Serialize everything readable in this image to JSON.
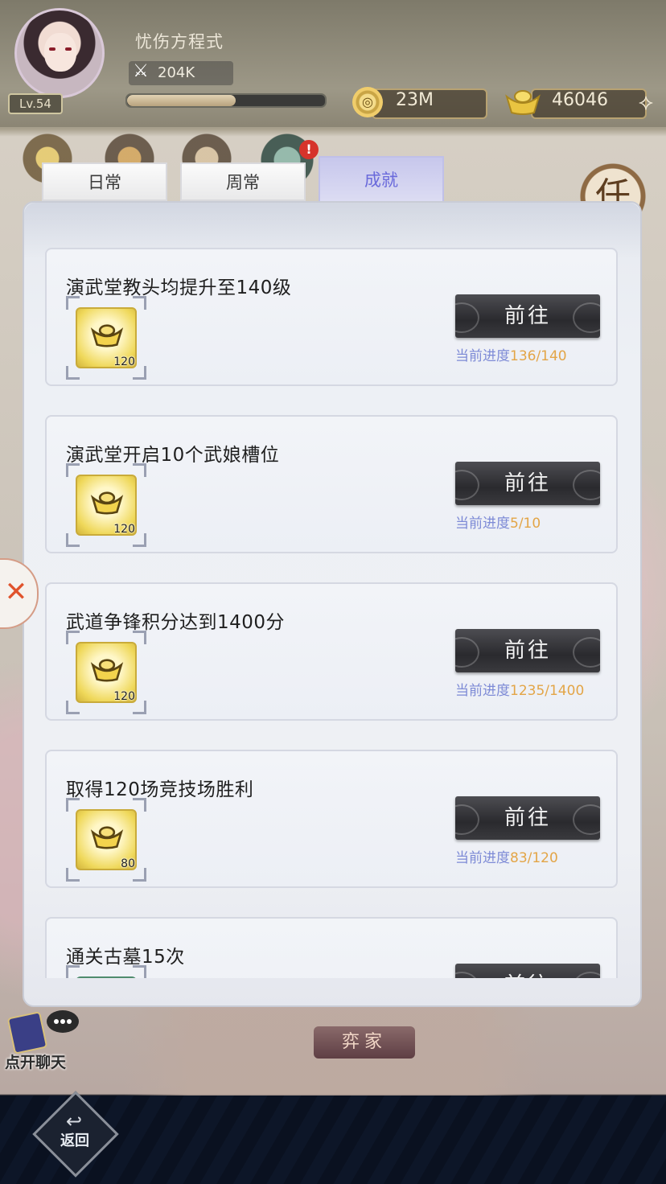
{
  "player": {
    "name": "忧伤方程式",
    "level": "Lv.54",
    "power": "204K",
    "xp_progress": 0.55
  },
  "currency": {
    "coins": "23M",
    "ingots": "46046",
    "add_icon": "plus-diamond-icon"
  },
  "tabs": [
    {
      "label": "日常",
      "selected": false
    },
    {
      "label": "周常",
      "selected": false
    },
    {
      "label": "成就",
      "selected": true
    }
  ],
  "side_badge": "任",
  "achievements": [
    {
      "title": "演武堂教头均提升至140级",
      "reward_qty": "120",
      "button": "前往",
      "progress_label": "当前进度",
      "progress_value": "136/140"
    },
    {
      "title": "演武堂开启10个武娘槽位",
      "reward_qty": "120",
      "button": "前往",
      "progress_label": "当前进度",
      "progress_value": "5/10"
    },
    {
      "title": "武道争锋积分达到1400分",
      "reward_qty": "120",
      "button": "前往",
      "progress_label": "当前进度",
      "progress_value": "1235/1400"
    },
    {
      "title": "取得120场竞技场胜利",
      "reward_qty": "80",
      "button": "前往",
      "progress_label": "当前进度",
      "progress_value": "83/120"
    },
    {
      "title": "通关古墓15次",
      "reward_qty": "",
      "button": "前往",
      "progress_label": "",
      "progress_value": ""
    }
  ],
  "bottom": {
    "stone_button": "弈家",
    "chat_label": "点开聊天",
    "back_label": "返回"
  },
  "colors": {
    "selected_tab": "#6a6adb",
    "progress_label": "#7d8ad6",
    "progress_value": "#e3a547",
    "go_button": "#2a2a2e"
  }
}
